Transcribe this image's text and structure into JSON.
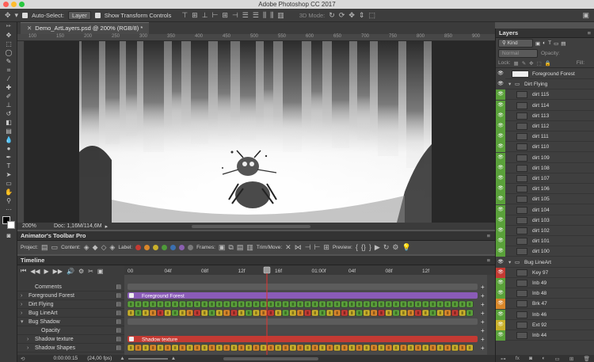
{
  "app": {
    "title": "Adobe Photoshop CC 2017"
  },
  "options_bar": {
    "auto_select_label": "Auto-Select:",
    "auto_select_value": "Layer",
    "transform_label": "Show Transform Controls",
    "mode_label": "3D Mode:"
  },
  "document": {
    "tab_title": "Demo_ArtLayers.psd @ 200% (RGB/8) *",
    "zoom": "200%",
    "doc_size": "Doc: 1,16M/114,6M",
    "ruler_labels": [
      "100",
      "150",
      "200",
      "250",
      "300",
      "350",
      "400",
      "450",
      "500",
      "550",
      "600",
      "650",
      "700",
      "750",
      "800",
      "850",
      "900"
    ]
  },
  "animator_toolbar": {
    "title": "Animator's Toolbar Pro",
    "project_label": "Project:",
    "content_label": "Content:",
    "label_label": "Label:",
    "frames_label": "Frames:",
    "trim_label": "Trim/Move:",
    "preview_label": "Preview:",
    "label_colors": [
      "#c43a33",
      "#d9872a",
      "#c9b02b",
      "#4f9a3a",
      "#3b6fb0",
      "#8b5fb0",
      "#7a7a7a"
    ]
  },
  "timeline": {
    "title": "Timeline",
    "ruler_labels": [
      "00",
      "04f",
      "08f",
      "12f",
      "16f",
      "01:00f",
      "04f",
      "08f",
      "12f"
    ],
    "layers": [
      {
        "name": "Comments",
        "indent": 1
      },
      {
        "name": "Foreground Forest",
        "indent": 0
      },
      {
        "name": "Dirt Flying",
        "indent": 0
      },
      {
        "name": "Bug LineArt",
        "indent": 0
      },
      {
        "name": "Bug Shadow",
        "indent": 0
      },
      {
        "name": "Opacity",
        "indent": 2
      },
      {
        "name": "Shadow texture",
        "indent": 1
      },
      {
        "name": "Shadow Shapes",
        "indent": 1
      }
    ],
    "tracks": [
      {
        "type": "comment",
        "color": "#5c5c5c"
      },
      {
        "type": "bar",
        "color": "#8a5bb7",
        "label": "Foreground Forest"
      },
      {
        "type": "frames",
        "colors": [
          "#5aa13a"
        ]
      },
      {
        "type": "frames",
        "colors": [
          "#c9b02b",
          "#5aa13a",
          "#c9b02b",
          "#d9872a",
          "#c43a33"
        ]
      },
      {
        "type": "group",
        "color": "#5c5c5c"
      },
      {
        "type": "empty",
        "color": "#4a4a4a"
      },
      {
        "type": "bar",
        "color": "#c43a33",
        "label": "Shadow texture"
      },
      {
        "type": "frames",
        "colors": [
          "#c9b02b",
          "#d9872a"
        ]
      }
    ],
    "timecode": "0:00:00:15",
    "fps": "(24,00 fps)"
  },
  "layers_panel": {
    "title": "Layers",
    "filter_kind": "Kind",
    "blend_mode": "Normal",
    "opacity_label": "Opacity:",
    "lock_label": "Lock:",
    "fill_label": "Fill:",
    "items": [
      {
        "name": "Foreground Forest",
        "eye": "#3f3f3f",
        "indent": 0,
        "kind": "layer"
      },
      {
        "name": "Dirt Flying",
        "eye": "#3f3f3f",
        "indent": 0,
        "kind": "group"
      },
      {
        "name": "dirt 115",
        "eye": "#5aa13a",
        "indent": 1,
        "kind": "layer"
      },
      {
        "name": "dirt 114",
        "eye": "#5aa13a",
        "indent": 1,
        "kind": "layer"
      },
      {
        "name": "dirt 113",
        "eye": "#5aa13a",
        "indent": 1,
        "kind": "layer"
      },
      {
        "name": "dirt 112",
        "eye": "#5aa13a",
        "indent": 1,
        "kind": "layer"
      },
      {
        "name": "dirt 111",
        "eye": "#5aa13a",
        "indent": 1,
        "kind": "layer"
      },
      {
        "name": "dirt 110",
        "eye": "#5aa13a",
        "indent": 1,
        "kind": "layer"
      },
      {
        "name": "dirt 109",
        "eye": "#5aa13a",
        "indent": 1,
        "kind": "layer"
      },
      {
        "name": "dirt 108",
        "eye": "#5aa13a",
        "indent": 1,
        "kind": "layer"
      },
      {
        "name": "dirt 107",
        "eye": "#5aa13a",
        "indent": 1,
        "kind": "layer"
      },
      {
        "name": "dirt 106",
        "eye": "#5aa13a",
        "indent": 1,
        "kind": "layer"
      },
      {
        "name": "dirt 105",
        "eye": "#5aa13a",
        "indent": 1,
        "kind": "layer"
      },
      {
        "name": "dirt 104",
        "eye": "#5aa13a",
        "indent": 1,
        "kind": "layer"
      },
      {
        "name": "dirt 103",
        "eye": "#5aa13a",
        "indent": 1,
        "kind": "layer"
      },
      {
        "name": "dirt 102",
        "eye": "#5aa13a",
        "indent": 1,
        "kind": "layer"
      },
      {
        "name": "dirt 101",
        "eye": "#5aa13a",
        "indent": 1,
        "kind": "layer"
      },
      {
        "name": "dirt 100",
        "eye": "#5aa13a",
        "indent": 1,
        "kind": "layer"
      },
      {
        "name": "Bug LineArt",
        "eye": "#3f3f3f",
        "indent": 0,
        "kind": "group"
      },
      {
        "name": "Key  97",
        "eye": "#c43a33",
        "indent": 1,
        "kind": "layer"
      },
      {
        "name": "Inb 49",
        "eye": "#5aa13a",
        "indent": 1,
        "kind": "layer"
      },
      {
        "name": "Inb 48",
        "eye": "#5aa13a",
        "indent": 1,
        "kind": "layer"
      },
      {
        "name": "Brk 47",
        "eye": "#d9872a",
        "indent": 1,
        "kind": "layer"
      },
      {
        "name": "Inb 46",
        "eye": "#5aa13a",
        "indent": 1,
        "kind": "layer"
      },
      {
        "name": "Ext  92",
        "eye": "#c9b02b",
        "indent": 1,
        "kind": "layer"
      },
      {
        "name": "Inb 44",
        "eye": "#5aa13a",
        "indent": 1,
        "kind": "layer"
      }
    ]
  }
}
